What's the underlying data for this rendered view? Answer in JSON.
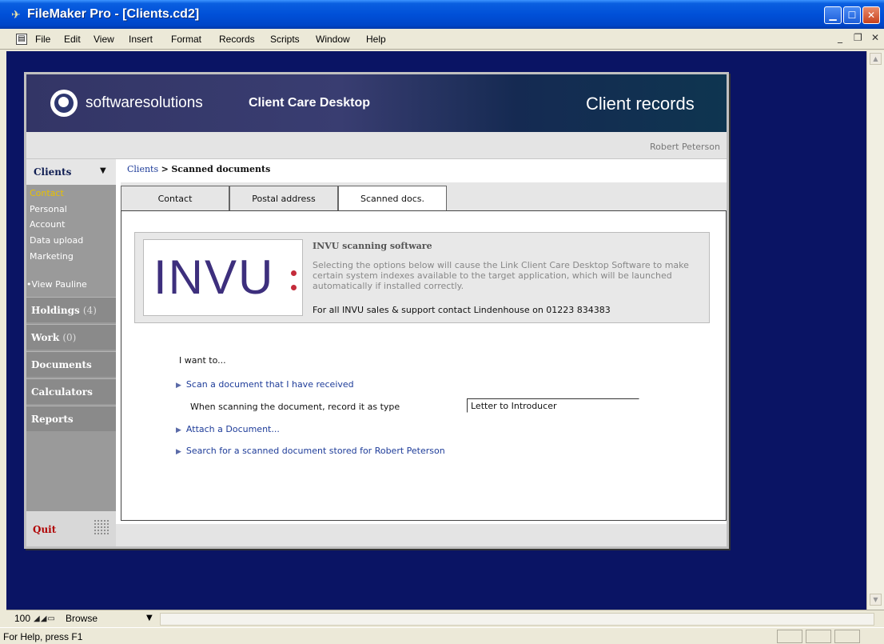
{
  "window": {
    "title": "FileMaker Pro - [Clients.cd2]"
  },
  "menubar": {
    "items": [
      "File",
      "Edit",
      "View",
      "Insert",
      "Format",
      "Records",
      "Scripts",
      "Window",
      "Help"
    ]
  },
  "banner": {
    "brand_name": "softwaresolutions",
    "product_name": "Client Care Desktop",
    "section_title": "Client records"
  },
  "user": {
    "name": "Robert Peterson"
  },
  "nav": {
    "section": "Clients",
    "sub_items": [
      {
        "label": "Contact",
        "active": true
      },
      {
        "label": "Personal",
        "active": false
      },
      {
        "label": "Account",
        "active": false
      },
      {
        "label": "Data upload",
        "active": false
      },
      {
        "label": "Marketing",
        "active": false
      },
      {
        "label": "View Pauline",
        "active": false
      }
    ],
    "sections": [
      {
        "label": "Holdings",
        "count": "(4)"
      },
      {
        "label": "Work",
        "count": "(0)"
      },
      {
        "label": "Documents",
        "count": ""
      },
      {
        "label": "Calculators",
        "count": ""
      },
      {
        "label": "Reports",
        "count": ""
      }
    ],
    "quit_label": "Quit"
  },
  "breadcrumb": {
    "root": "Clients",
    "separator": ">",
    "current": "Scanned documents"
  },
  "tabs": [
    {
      "label": "Contact",
      "active": false
    },
    {
      "label": "Postal address",
      "active": false
    },
    {
      "label": "Scanned docs.",
      "active": true
    }
  ],
  "invu": {
    "logo_text": "INVU",
    "title": "INVU scanning software",
    "description": "Selecting the options below will cause the Link Client Care Desktop Software to make certain system indexes available to the target application, which will be launched automatically if installed correctly.",
    "contact": "For all INVU sales & support contact Lindenhouse on 01223 834383"
  },
  "actions": {
    "heading": "I want to...",
    "scan_label": "Scan a document that I have received",
    "type_prompt": "When scanning the document, record it as type",
    "type_value": "Letter to Introducer",
    "attach_label": "Attach a Document...",
    "search_label": "Search for a scanned document stored for Robert Peterson"
  },
  "statusbar": {
    "zoom": "100",
    "mode": "Browse",
    "help_text": "For Help, press F1"
  },
  "colors": {
    "titlebar": "#0050d8",
    "mdi_background": "#0a1464",
    "banner": "#333566",
    "link": "#1e3c99",
    "nav_active": "#e8c100",
    "quit": "#b00000",
    "invu_logo": "#3d2f7d"
  }
}
